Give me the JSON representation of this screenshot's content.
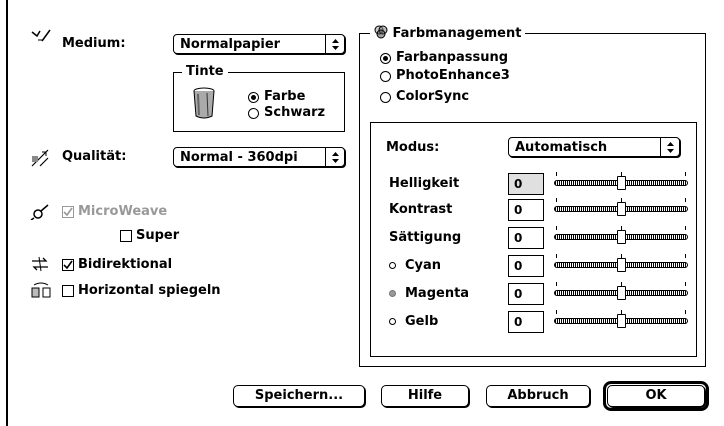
{
  "left": {
    "medium_label": "Medium:",
    "medium_value": "Normalpapier",
    "tinte": {
      "title": "Tinte",
      "farbe": "Farbe",
      "schwarz": "Schwarz",
      "selected": "Farbe"
    },
    "qualitaet_label": "Qualität:",
    "qualitaet_value": "Normal - 360dpi",
    "microweave": {
      "label": "MicroWeave",
      "checked": true,
      "enabled": false
    },
    "super": {
      "label": "Super",
      "checked": false
    },
    "bidirektional": {
      "label": "Bidirektional",
      "checked": true
    },
    "horizontal": {
      "label": "Horizontal spiegeln",
      "checked": false
    }
  },
  "farbmanagement": {
    "title": "Farbmanagement",
    "options": [
      "Farbanpassung",
      "PhotoEnhance3",
      "ColorSync"
    ],
    "selected": "Farbanpassung",
    "modus_label": "Modus:",
    "modus_value": "Automatisch",
    "sliders": [
      {
        "label": "Helligkeit",
        "value": "0",
        "disabled_field": true,
        "dot": null
      },
      {
        "label": "Kontrast",
        "value": "0",
        "disabled_field": false,
        "dot": null
      },
      {
        "label": "Sättigung",
        "value": "0",
        "disabled_field": false,
        "dot": null
      },
      {
        "label": "Cyan",
        "value": "0",
        "disabled_field": false,
        "dot": "#ffffff"
      },
      {
        "label": "Magenta",
        "value": "0",
        "disabled_field": false,
        "dot": "#999999"
      },
      {
        "label": "Gelb",
        "value": "0",
        "disabled_field": false,
        "dot": "#ffffff"
      }
    ],
    "slider_position": 0.5
  },
  "buttons": {
    "speichern": "Speichern...",
    "hilfe": "Hilfe",
    "abbruch": "Abbruch",
    "ok": "OK"
  },
  "icons": {
    "medium": "paper-feed-icon",
    "tinte": "ink-bucket-icon",
    "qualitaet": "quality-icon",
    "microweave": "microweave-icon",
    "bidirektional": "bidirectional-icon",
    "horizontal": "flip-horizontal-icon",
    "farbmanagement": "color-management-icon"
  },
  "colors": {
    "background": "#ffffff",
    "foreground": "#000000",
    "disabled_text": "#999999",
    "disabled_field": "#e0e0e0"
  }
}
